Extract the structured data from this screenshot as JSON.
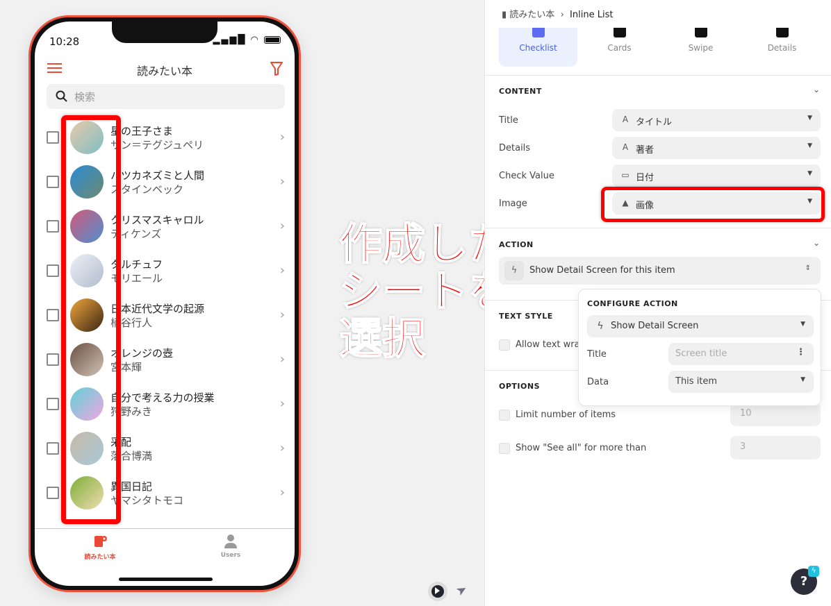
{
  "phone": {
    "status_time": "10:28",
    "app_title": "読みたい本",
    "search_placeholder": "検索",
    "items": [
      {
        "title": "星の王子さま",
        "details": "サン＝テグジュペリ",
        "colors": [
          "#e8c9a8",
          "#7fbfc7"
        ]
      },
      {
        "title": "ハツカネズミと人間",
        "details": "スタインベック",
        "colors": [
          "#2c8ad6",
          "#6c8a70"
        ]
      },
      {
        "title": "クリスマスキャロル",
        "details": "ディケンズ",
        "colors": [
          "#d25a7a",
          "#4f8fd0"
        ]
      },
      {
        "title": "タルチュフ",
        "details": "モリエール",
        "colors": [
          "#eef0f6",
          "#b0bccd"
        ]
      },
      {
        "title": "日本近代文学の起源",
        "details": "柄谷行人",
        "colors": [
          "#f0a53a",
          "#3b2616"
        ]
      },
      {
        "title": "オレンジの壺",
        "details": "宮本輝",
        "colors": [
          "#6b5143",
          "#d0c2b5"
        ]
      },
      {
        "title": "自分で考える力の授業",
        "details": "狩野みき",
        "colors": [
          "#5fd0d8",
          "#f0a8e0"
        ]
      },
      {
        "title": "采配",
        "details": "落合博満",
        "colors": [
          "#c8b9a8",
          "#a8c8d8"
        ]
      },
      {
        "title": "異国日記",
        "details": "ヤマシタトモコ",
        "colors": [
          "#7dae3a",
          "#f0dcb0"
        ]
      }
    ],
    "tabs": [
      {
        "label": "読みたい本",
        "active": true
      },
      {
        "label": "Users",
        "active": false
      }
    ],
    "accent": "#e84a35"
  },
  "annotation": {
    "text": "作成した\nシートを\n選択",
    "color": "#ff0000"
  },
  "panel": {
    "breadcrumb": {
      "parent": "読みたい本",
      "current": "Inline List"
    },
    "styles": [
      {
        "label": "Checklist",
        "selected": true
      },
      {
        "label": "Cards",
        "selected": false
      },
      {
        "label": "Swipe",
        "selected": false
      },
      {
        "label": "Details",
        "selected": false
      }
    ],
    "content": {
      "heading": "CONTENT",
      "rows": [
        {
          "label": "Title",
          "value": "タイトル",
          "icon": "text-icon"
        },
        {
          "label": "Details",
          "value": "著者",
          "icon": "text-icon"
        },
        {
          "label": "Check Value",
          "value": "日付",
          "icon": "calendar-icon"
        },
        {
          "label": "Image",
          "value": "画像",
          "icon": "image-icon"
        }
      ]
    },
    "action": {
      "heading": "ACTION",
      "value": "Show Detail Screen for this item"
    },
    "configure": {
      "heading": "CONFIGURE ACTION",
      "action_value": "Show Detail Screen",
      "title_label": "Title",
      "title_placeholder": "Screen title",
      "data_label": "Data",
      "data_value": "This item"
    },
    "text_style": {
      "heading": "TEXT STYLE",
      "allow_wrap": "Allow text wrap"
    },
    "options": {
      "heading": "OPTIONS",
      "limit_label": "Limit number of items",
      "limit_value": "10",
      "see_all_label": "Show \"See all\" for more than",
      "see_all_value": "3"
    },
    "help": "?"
  }
}
